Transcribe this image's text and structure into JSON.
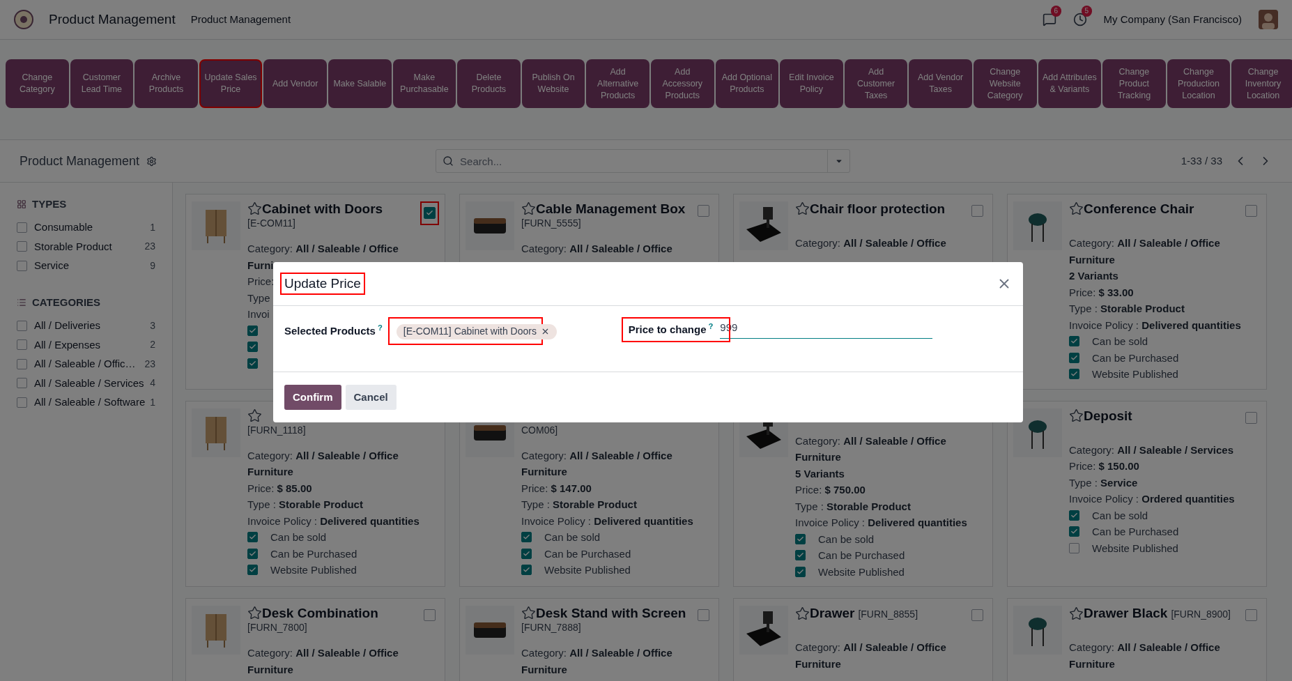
{
  "topbar": {
    "app_name": "Product Management",
    "menu": "Product Management",
    "messages_badge": "6",
    "activities_badge": "5",
    "company": "My Company (San Francisco)"
  },
  "actions": [
    {
      "label": "Change Category",
      "highlighted": false
    },
    {
      "label": "Customer Lead Time",
      "highlighted": false
    },
    {
      "label": "Archive Products",
      "highlighted": false
    },
    {
      "label": "Update Sales Price",
      "highlighted": true
    },
    {
      "label": "Add Vendor",
      "highlighted": false
    },
    {
      "label": "Make Salable",
      "highlighted": false
    },
    {
      "label": "Make Purchasable",
      "highlighted": false
    },
    {
      "label": "Delete Products",
      "highlighted": false
    },
    {
      "label": "Publish On Website",
      "highlighted": false
    },
    {
      "label": "Add Alternative Products",
      "highlighted": false
    },
    {
      "label": "Add Accessory Products",
      "highlighted": false
    },
    {
      "label": "Add Optional Products",
      "highlighted": false
    },
    {
      "label": "Edit Invoice Policy",
      "highlighted": false
    },
    {
      "label": "Add Customer Taxes",
      "highlighted": false
    },
    {
      "label": "Add Vendor Taxes",
      "highlighted": false
    },
    {
      "label": "Change Website Category",
      "highlighted": false
    },
    {
      "label": "Add Attributes & Variants",
      "highlighted": false
    },
    {
      "label": "Change Product Tracking",
      "highlighted": false
    },
    {
      "label": "Change Production Location",
      "highlighted": false
    },
    {
      "label": "Change Inventory Location",
      "highlighted": false
    }
  ],
  "control_panel": {
    "title": "Product Management",
    "search": {
      "placeholder": "Search..."
    },
    "pager": "1-33 / 33"
  },
  "sidebar": [
    {
      "title": "TYPES",
      "kind": "grid",
      "items": [
        {
          "label": "Consumable",
          "count": "1",
          "checked": false
        },
        {
          "label": "Storable Product",
          "count": "23",
          "checked": false
        },
        {
          "label": "Service",
          "count": "9",
          "checked": false
        }
      ]
    },
    {
      "title": "CATEGORIES",
      "kind": "list",
      "items": [
        {
          "label": "All / Deliveries",
          "count": "3",
          "checked": false
        },
        {
          "label": "All / Expenses",
          "count": "2",
          "checked": false
        },
        {
          "label": "All / Saleable / Offic…",
          "count": "23",
          "checked": false
        },
        {
          "label": "All / Saleable / Services",
          "count": "4",
          "checked": false
        },
        {
          "label": "All / Saleable / Software",
          "count": "1",
          "checked": false
        }
      ]
    }
  ],
  "cards": [
    {
      "name": "Cabinet with Doors",
      "code": "[E-COM11]",
      "favorite": false,
      "selected": true,
      "highlighted": true,
      "lines": [
        {
          "label": "Category:",
          "value": "All / Saleable / Office"
        },
        {
          "value": "Furni"
        },
        {
          "label": "Price:"
        },
        {
          "label": "Type"
        },
        {
          "label": "Invoi"
        }
      ],
      "flags": [
        {
          "checked": true
        },
        {
          "checked": true
        },
        {
          "checked": true
        }
      ]
    },
    {
      "name": "Cable Management Box",
      "code": "[FURN_5555]",
      "favorite": false,
      "selected": false,
      "highlighted": false,
      "lines": [
        {
          "label": "Category:",
          "value": "All / Saleable / Office"
        }
      ]
    },
    {
      "name": "Chair floor protection",
      "favorite": false,
      "selected": false,
      "highlighted": false,
      "lines": [
        {
          "label": "Category:",
          "value": "All / Saleable / Office"
        }
      ]
    },
    {
      "name": "Conference Chair",
      "favorite": false,
      "selected": false,
      "highlighted": false,
      "lines": [
        {
          "label": "Category:",
          "value": "All / Saleable / Office Furniture"
        },
        {
          "value": "2 Variants"
        },
        {
          "label": "Price:",
          "value": "$ 33.00"
        },
        {
          "label": "Type :",
          "value": "Storable Product"
        },
        {
          "label": "Invoice Policy :",
          "value": "Delivered quantities"
        }
      ],
      "flags": [
        {
          "label": "Can be sold",
          "checked": true
        },
        {
          "label": "Can be Purchased",
          "checked": true
        },
        {
          "label": "Website Published",
          "checked": true
        }
      ]
    },
    {
      "code": "[FURN_1118]",
      "favorite": false,
      "lines": [
        {
          "label": "Category:",
          "value": "All / Saleable / Office Furniture"
        },
        {
          "label": "Price:",
          "value": "$ 85.00"
        },
        {
          "label": "Type :",
          "value": "Storable Product"
        },
        {
          "label": "Invoice Policy :",
          "value": "Delivered quantities"
        }
      ],
      "flags": [
        {
          "label": "Can be sold",
          "checked": true
        },
        {
          "label": "Can be Purchased",
          "checked": true
        },
        {
          "label": "Website Published",
          "checked": true
        }
      ]
    },
    {
      "code": "COM06]",
      "lines": [
        {
          "label": "Category:",
          "value": "All / Saleable / Office Furniture"
        },
        {
          "label": "Price:",
          "value": "$ 147.00"
        },
        {
          "label": "Type :",
          "value": "Storable Product"
        },
        {
          "label": "Invoice Policy :",
          "value": "Delivered quantities"
        }
      ],
      "flags": [
        {
          "label": "Can be sold",
          "checked": true
        },
        {
          "label": "Can be Purchased",
          "checked": true
        },
        {
          "label": "Website Published",
          "checked": true
        }
      ]
    },
    {
      "lines": [
        {
          "label": "Category:",
          "value": "All / Saleable / Office Furniture"
        },
        {
          "value": "5 Variants"
        },
        {
          "label": "Price:",
          "value": "$ 750.00"
        },
        {
          "label": "Type :",
          "value": "Storable Product"
        },
        {
          "label": "Invoice Policy :",
          "value": "Delivered quantities"
        }
      ],
      "flags": [
        {
          "label": "Can be sold",
          "checked": true
        },
        {
          "label": "Can be Purchased",
          "checked": true
        },
        {
          "label": "Website Published",
          "checked": true
        }
      ]
    },
    {
      "name": "Deposit",
      "favorite": false,
      "selected": false,
      "highlighted": false,
      "lines": [
        {
          "label": "Category:",
          "value": "All / Saleable / Services"
        },
        {
          "label": "Price:",
          "value": "$ 150.00"
        },
        {
          "label": "Type :",
          "value": "Service"
        },
        {
          "label": "Invoice Policy :",
          "value": "Ordered quantities"
        }
      ],
      "flags": [
        {
          "label": "Can be sold",
          "checked": true
        },
        {
          "label": "Can be Purchased",
          "checked": true
        },
        {
          "label": "Website Published",
          "checked": false
        }
      ]
    },
    {
      "name": "Desk Combination",
      "code": "[FURN_7800]",
      "favorite": false,
      "selected": false,
      "highlighted": false,
      "lines": [
        {
          "label": "Category:",
          "value": "All / Saleable / Office Furniture"
        }
      ]
    },
    {
      "name": "Desk Stand with Screen",
      "code": "[FURN_7888]",
      "favorite": false,
      "selected": false,
      "highlighted": false,
      "lines": [
        {
          "label": "Category:",
          "value": "All / Saleable / Office Furniture"
        }
      ]
    },
    {
      "name": "Drawer",
      "code": "[FURN_8855]",
      "favorite": false,
      "selected": false,
      "highlighted": false,
      "lines": [
        {
          "label": "Category:",
          "value": "All / Saleable / Office Furniture"
        }
      ]
    },
    {
      "name": "Drawer Black",
      "code": "[FURN_8900]",
      "favorite": false,
      "selected": false,
      "highlighted": false,
      "lines": [
        {
          "label": "Category:",
          "value": "All / Saleable / Office Furniture"
        }
      ]
    }
  ],
  "dialog": {
    "title": "Update Price",
    "title_highlighted": true,
    "selected_products": {
      "label": "Selected Products",
      "help": "?",
      "highlighted": true,
      "tags": [
        "[E-COM11] Cabinet with Doors"
      ]
    },
    "price": {
      "label": "Price to change",
      "help": "?",
      "value": "999",
      "highlighted": true
    },
    "buttons": [
      {
        "label": "Confirm",
        "kind": "primary"
      },
      {
        "label": "Cancel",
        "kind": "secondary"
      }
    ]
  }
}
